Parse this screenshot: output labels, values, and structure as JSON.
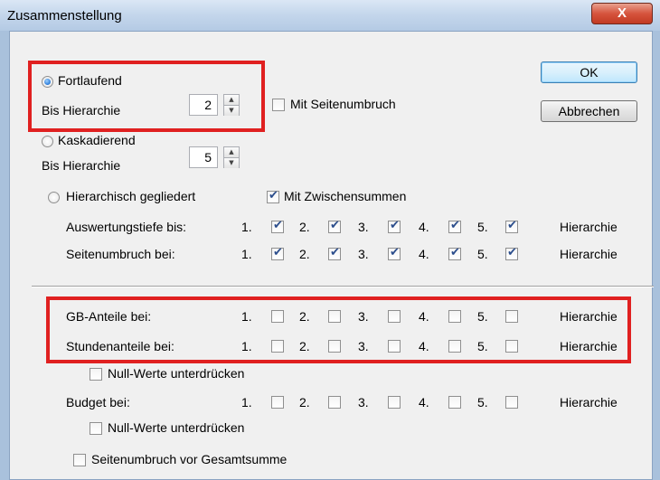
{
  "window": {
    "title": "Zusammenstellung",
    "close_label": "X"
  },
  "buttons": {
    "ok": "OK",
    "cancel": "Abbrechen"
  },
  "fortlaufend": {
    "label": "Fortlaufend",
    "hier_label": "Bis Hierarchie",
    "value": "2",
    "pagebreak_label": "Mit Seitenumbruch"
  },
  "kaskadierend": {
    "label": "Kaskadierend",
    "hier_label": "Bis Hierarchie",
    "value": "5"
  },
  "hierarchisch": {
    "label": "Hierarchisch gegliedert",
    "subtotals_label": "Mit Zwischensummen"
  },
  "levels": [
    "1.",
    "2.",
    "3.",
    "4.",
    "5."
  ],
  "hierarchie_label": "Hierarchie",
  "rows": {
    "auswertung": "Auswertungstiefe bis:",
    "seitenumbruch": "Seitenumbruch bei:",
    "gb": "GB-Anteile bei:",
    "stunden": "Stundenanteile bei:",
    "budget": "Budget bei:"
  },
  "null_werte_label": "Null-Werte unterdrücken",
  "budget_null_werte_label": "Null-Werte unterdrücken",
  "gesamtsumme_label": "Seitenumbruch vor Gesamtsumme"
}
